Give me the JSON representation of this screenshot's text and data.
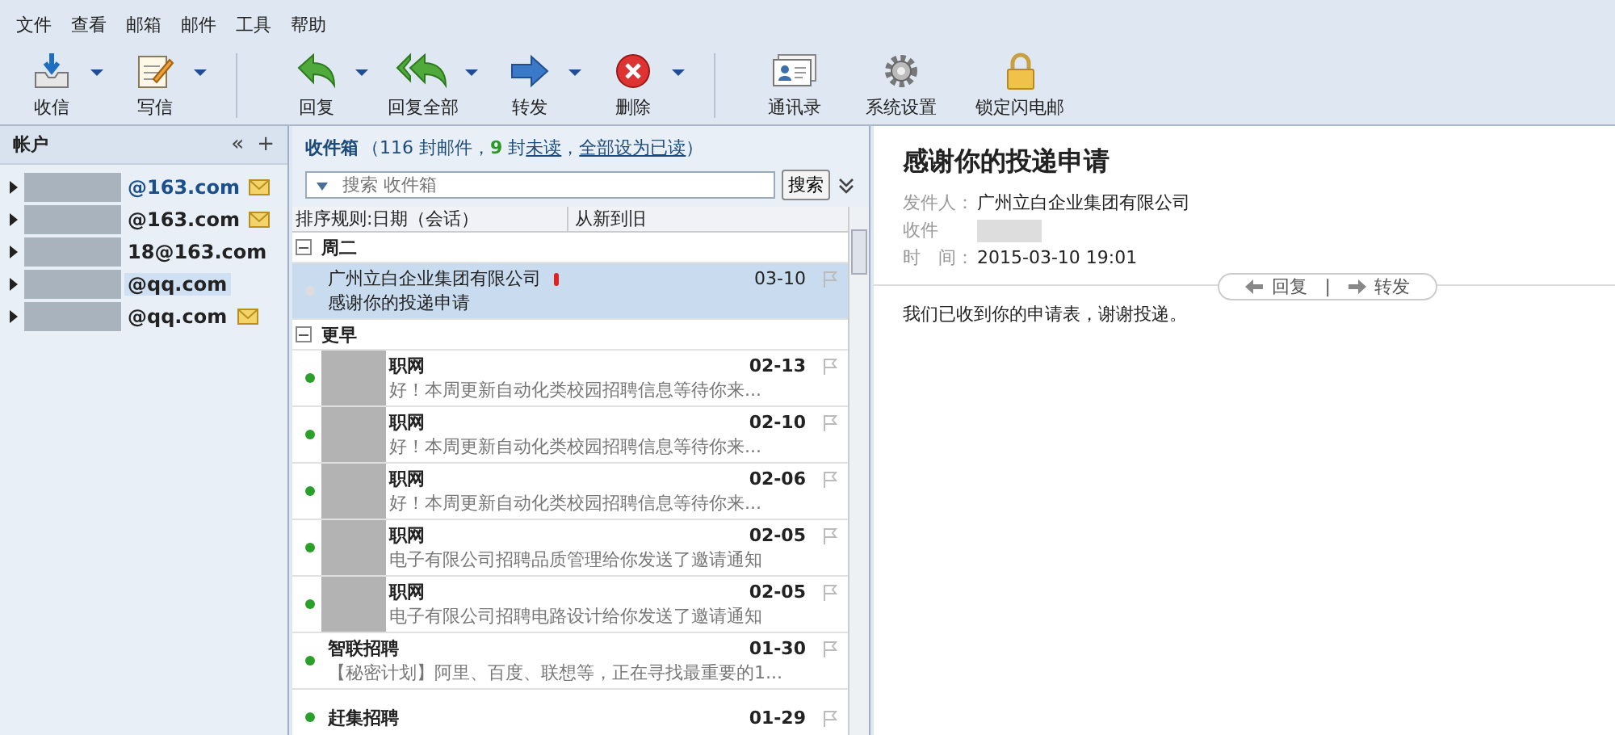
{
  "menu": [
    "文件",
    "查看",
    "邮箱",
    "邮件",
    "工具",
    "帮助"
  ],
  "toolbar": [
    {
      "kind": "receive",
      "label": "收信",
      "dropdown": true,
      "separator_before": false
    },
    {
      "kind": "compose",
      "label": "写信",
      "dropdown": true,
      "separator_before": false
    },
    {
      "kind": "reply",
      "label": "回复",
      "dropdown": true,
      "separator_before": true
    },
    {
      "kind": "replyall",
      "label": "回复全部",
      "dropdown": true,
      "separator_before": false
    },
    {
      "kind": "forward",
      "label": "转发",
      "dropdown": true,
      "separator_before": false
    },
    {
      "kind": "delete",
      "label": "删除",
      "dropdown": true,
      "separator_before": false
    },
    {
      "kind": "contacts",
      "label": "通讯录",
      "dropdown": false,
      "separator_before": true
    },
    {
      "kind": "settings",
      "label": "系统设置",
      "dropdown": false,
      "separator_before": false
    },
    {
      "kind": "lock",
      "label": "锁定闪电邮",
      "dropdown": false,
      "separator_before": false
    }
  ],
  "accounts": {
    "title": "帐户",
    "collapse": "«",
    "add": "+",
    "items": [
      {
        "address": "@163.com",
        "unread": true,
        "selected": false,
        "active": true
      },
      {
        "address": "@163.com",
        "unread": true,
        "selected": false,
        "active": false
      },
      {
        "address": "18@163.com",
        "unread": false,
        "selected": false,
        "active": false
      },
      {
        "address": "@qq.com",
        "unread": false,
        "selected": true,
        "active": false
      },
      {
        "address": "@qq.com",
        "unread": true,
        "selected": false,
        "active": false
      }
    ]
  },
  "inbox": {
    "title": "收件箱",
    "open": "（",
    "count": "116 封邮件，",
    "unread_count": "9",
    "unread_text": "封",
    "unread_link": "未读",
    "sep": "，",
    "mark_all": "全部设为已读",
    "close": "）",
    "search_placeholder": "搜索 收件箱",
    "search_button": "搜索",
    "sort_label": "排序规则:日期（会话）",
    "sort_order": "从新到旧",
    "groups": [
      {
        "name": "周二",
        "mails": [
          {
            "sender": "广州立白企业集团有限公司",
            "subject": "感谢你的投递申请",
            "date": "03-10",
            "unread": false,
            "important": true,
            "selected": true,
            "masked": false
          }
        ]
      },
      {
        "name": "更早",
        "mails": [
          {
            "sender": "职网",
            "subject": "好！本周更新自动化类校园招聘信息等待你来...",
            "date": "02-13",
            "unread": true,
            "important": false,
            "selected": false,
            "masked": true
          },
          {
            "sender": "职网",
            "subject": "好！本周更新自动化类校园招聘信息等待你来...",
            "date": "02-10",
            "unread": true,
            "important": false,
            "selected": false,
            "masked": true
          },
          {
            "sender": "职网",
            "subject": "好！本周更新自动化类校园招聘信息等待你来...",
            "date": "02-06",
            "unread": true,
            "important": false,
            "selected": false,
            "masked": true
          },
          {
            "sender": "职网",
            "subject": "电子有限公司招聘品质管理给你发送了邀请通知",
            "date": "02-05",
            "unread": true,
            "important": false,
            "selected": false,
            "masked": true
          },
          {
            "sender": "职网",
            "subject": "电子有限公司招聘电路设计给你发送了邀请通知",
            "date": "02-05",
            "unread": true,
            "important": false,
            "selected": false,
            "masked": true
          },
          {
            "sender": "智联招聘",
            "subject": "【秘密计划】阿里、百度、联想等，正在寻找最重要的1...",
            "date": "01-30",
            "unread": true,
            "important": false,
            "selected": false,
            "masked": false
          },
          {
            "sender": "赶集招聘",
            "date": "01-29",
            "unread": true,
            "important": false,
            "selected": false,
            "masked": false
          }
        ]
      }
    ]
  },
  "message": {
    "subject": "感谢你的投递申请",
    "from_label": "发件人：",
    "from": "广州立白企业集团有限公司",
    "to_label": "收件",
    "time_label": "时　间：",
    "time": "2015-03-10  19:01",
    "reply": "回复",
    "divider": "|",
    "forward": "转发",
    "body": "我们已收到你的申请表，谢谢投递。"
  }
}
